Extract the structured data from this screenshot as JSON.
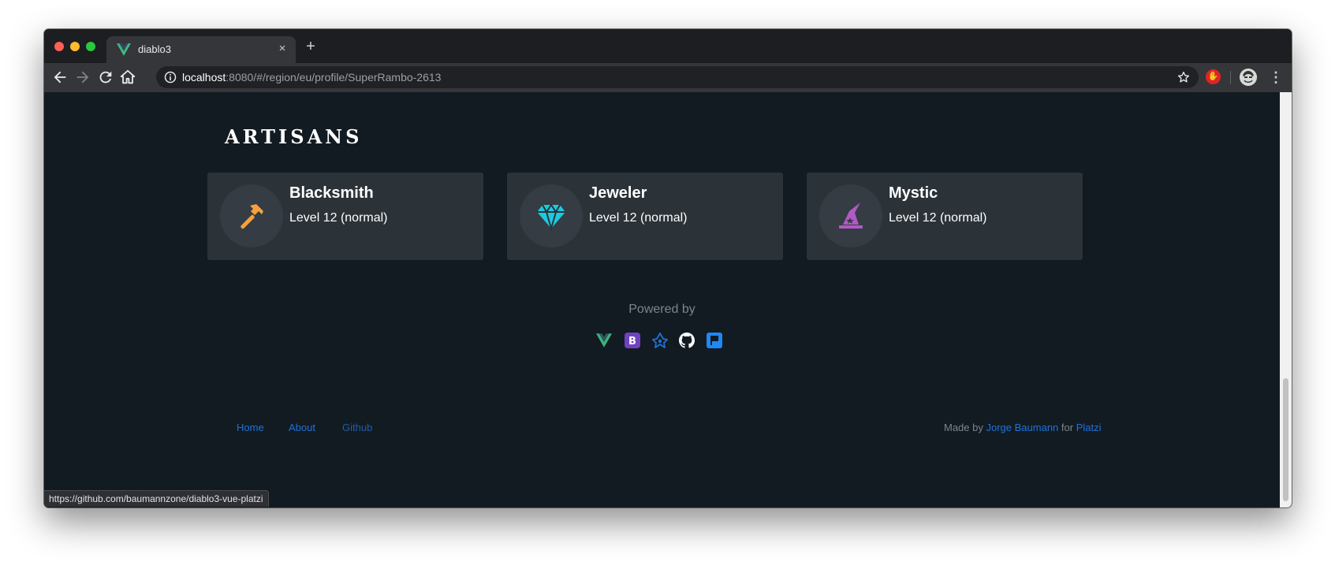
{
  "browser": {
    "tab_title": "diablo3",
    "new_tab_label": "+",
    "close_label": "×",
    "url_host": "localhost",
    "url_rest": ":8080/#/region/eu/profile/SuperRambo-2613",
    "status_url": "https://github.com/baumannzone/diablo3-vue-platzi",
    "icons": [
      "back-icon",
      "forward-icon",
      "reload-icon",
      "home-icon",
      "info-icon",
      "star-icon",
      "extension-icon",
      "avatar",
      "menu-icon"
    ]
  },
  "artisans": {
    "title": "ARTISANS",
    "cards": [
      {
        "name": "Blacksmith",
        "level": "Level 12 (normal)",
        "icon": "hammer-icon",
        "color": "#f5a03e"
      },
      {
        "name": "Jeweler",
        "level": "Level 12 (normal)",
        "icon": "diamond-icon",
        "color": "#1ec8e0"
      },
      {
        "name": "Mystic",
        "level": "Level 12 (normal)",
        "icon": "wizard-hat-icon",
        "color": "#b259c6"
      }
    ]
  },
  "powered": {
    "label": "Powered by",
    "icons": [
      {
        "name": "vue-icon",
        "color": "#3fb27f"
      },
      {
        "name": "bootstrap-icon",
        "color": "#6f42c1"
      },
      {
        "name": "axios-icon",
        "color": "#1f72d8"
      },
      {
        "name": "github-icon",
        "color": "#ffffff"
      },
      {
        "name": "flag-icon",
        "color": "#1e88f5"
      }
    ]
  },
  "footer": {
    "links": [
      "Home",
      "About",
      "Github"
    ],
    "made_by": "Made by",
    "author": "Jorge Baumann",
    "for": "for",
    "platform": "Platzi"
  }
}
